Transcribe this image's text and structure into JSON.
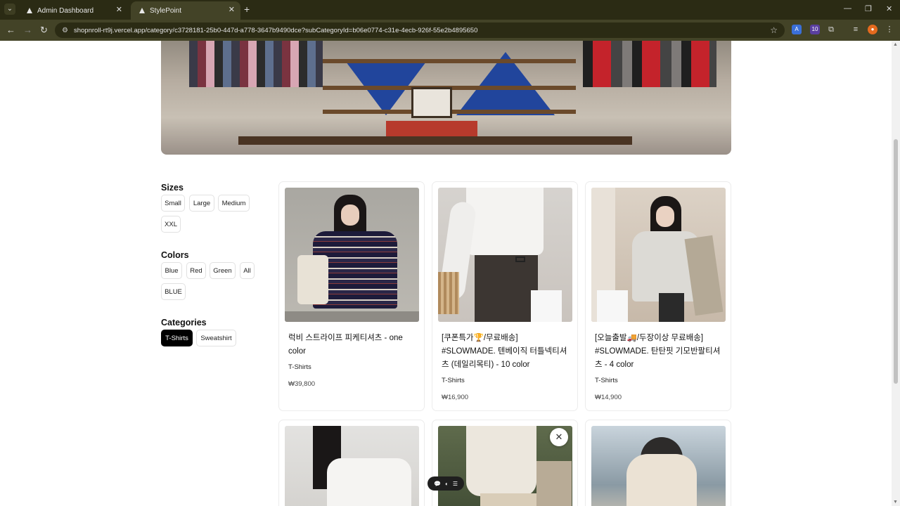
{
  "browser": {
    "tabs": [
      {
        "label": "Admin Dashboard",
        "active": false
      },
      {
        "label": "StylePoint",
        "active": true
      }
    ],
    "url": "shopnroll-rt9j.vercel.app/category/c3728181-25b0-447d-a778-3647b9490dce?subCategoryId=b06e0774-c31e-4ecb-926f-55e2b4895650",
    "extension_badge": "10"
  },
  "filters": {
    "sizes_title": "Sizes",
    "sizes": [
      "Small",
      "Large",
      "Medium",
      "XXL"
    ],
    "colors_title": "Colors",
    "colors": [
      "Blue",
      "Red",
      "Green",
      "All",
      "BLUE"
    ],
    "categories_title": "Categories",
    "categories": [
      {
        "label": "T-Shirts",
        "selected": true
      },
      {
        "label": "Sweatshirt",
        "selected": false
      }
    ]
  },
  "products": [
    {
      "title": "럭비 스트라이프 피케티셔츠 - one color",
      "category": "T-Shirts",
      "price": "₩39,800"
    },
    {
      "title": "[쿠폰특가🏆/무료배송] #SLOWMADE. 텐베이직 터틀넥티셔츠 (데일리목티) - 10 color",
      "category": "T-Shirts",
      "price": "₩16,900"
    },
    {
      "title": "[오늘출발🚚/두장이상 무료배송] #SLOWMADE. 탄탄핏 기모반팔티셔츠 - 4 color",
      "category": "T-Shirts",
      "price": "₩14,900"
    }
  ],
  "colors": {
    "accent": "#000000",
    "browser_frame": "#434327",
    "tabbar": "#2b2b14"
  }
}
